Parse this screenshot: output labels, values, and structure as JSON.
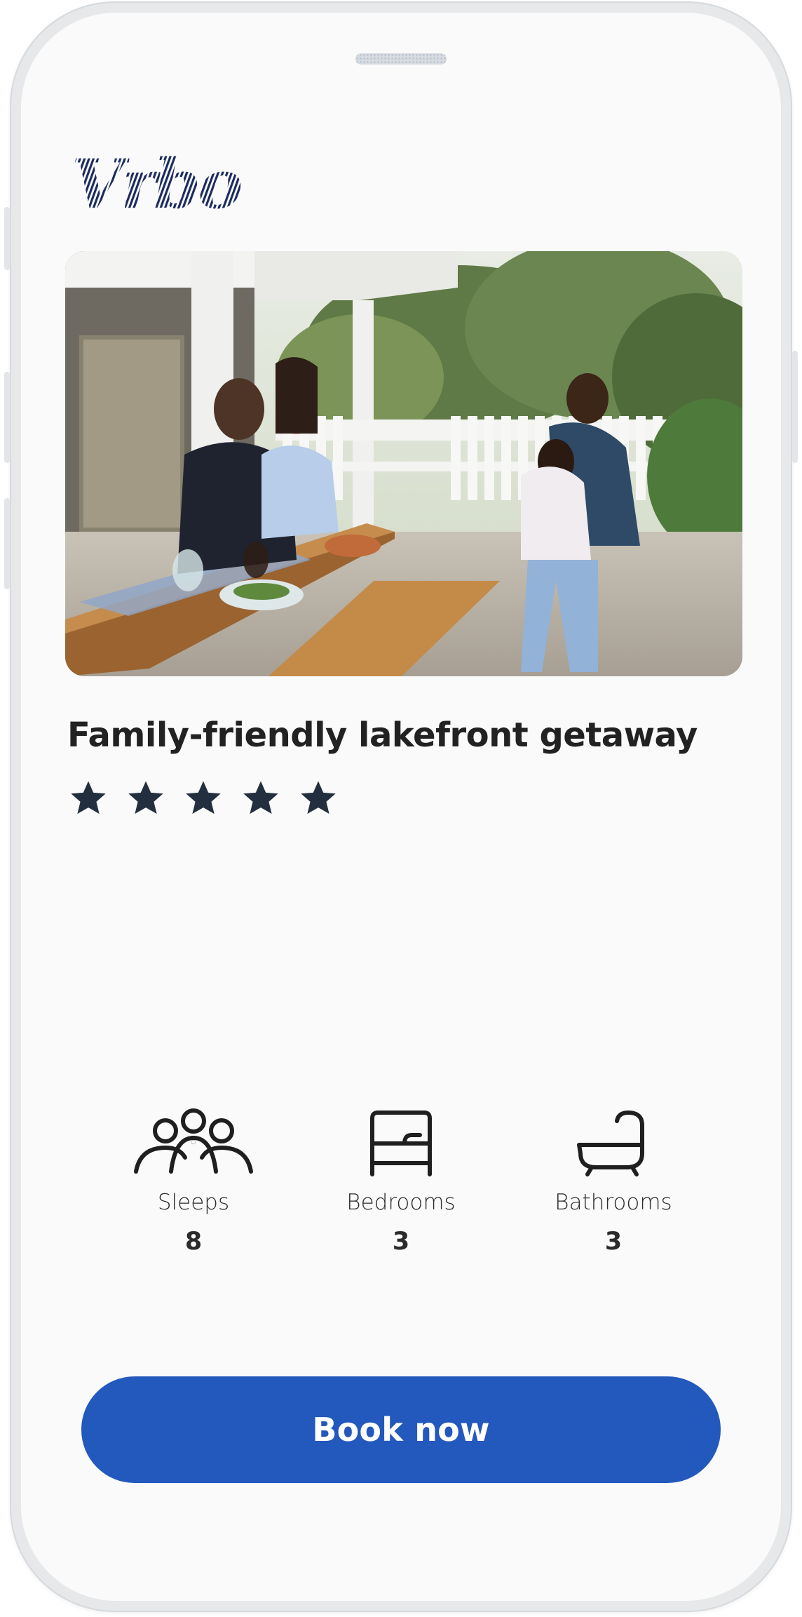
{
  "brand": {
    "logo_text": "Vrbo",
    "color": "#1b2b5e"
  },
  "listing": {
    "photo": "family-dining-on-patio",
    "title": "Family-friendly lakefront getaway",
    "rating": 5,
    "rating_max": 5,
    "star_color": "#232f3f"
  },
  "amenities": [
    {
      "icon": "people-icon",
      "label": "Sleeps",
      "value": "8"
    },
    {
      "icon": "bed-icon",
      "label": "Bedrooms",
      "value": "3"
    },
    {
      "icon": "bathtub-icon",
      "label": "Bathrooms",
      "value": "3"
    }
  ],
  "cta": {
    "label": "Book now",
    "color": "#2358bd"
  }
}
